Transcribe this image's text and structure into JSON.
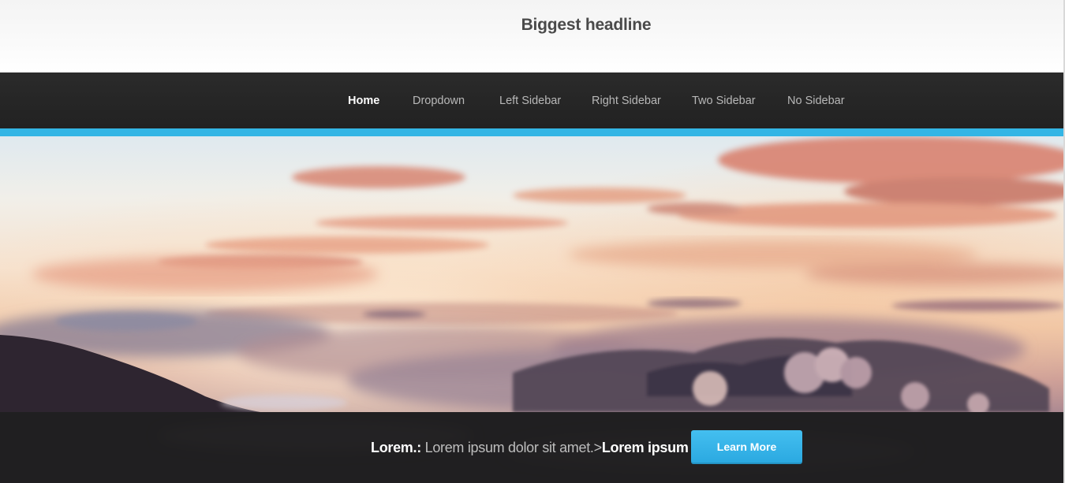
{
  "site": {
    "title": "Biggest headline"
  },
  "nav": {
    "items": [
      {
        "label": "Home",
        "active": true
      },
      {
        "label": "Dropdown",
        "active": false
      },
      {
        "label": "Left Sidebar",
        "active": false
      },
      {
        "label": "Right Sidebar",
        "active": false
      },
      {
        "label": "Two Sidebar",
        "active": false
      },
      {
        "label": "No Sidebar",
        "active": false
      }
    ]
  },
  "hero": {
    "caption_prefix": "Lorem.:",
    "caption_body": " Lorem ipsum dolor sit amet.>",
    "caption_link": "Lorem ipsum",
    "button_label": "Learn More"
  },
  "colors": {
    "accent": "#33b5e5",
    "nav_background": "#262626",
    "button": "#2aa8e0"
  }
}
